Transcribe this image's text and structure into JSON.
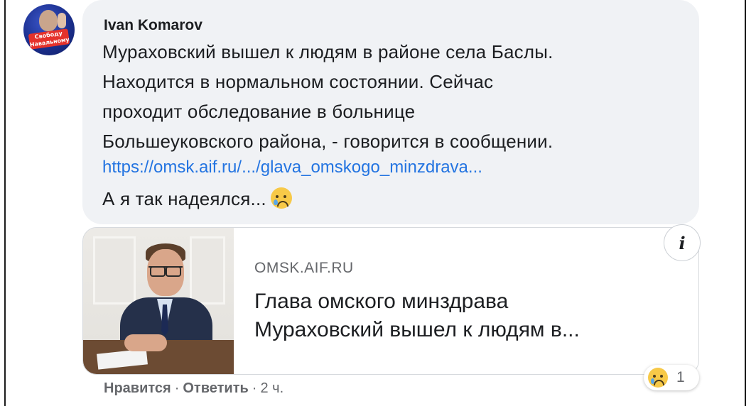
{
  "comment": {
    "author": "Ivan Komarov",
    "lines": [
      "Мураховский вышел к людям в районе села Баслы.",
      "Находится в нормальном состоянии. Сейчас",
      "проходит обследование в больнице",
      "Большеуковского района, - говорится в сообщении."
    ],
    "link": "https://omsk.aif.ru/.../glava_omskogo_minzdrava...",
    "last_line": "А я так надеялся...",
    "inline_emoji": "crying-face-icon"
  },
  "avatar": {
    "badge_text": "Свободу Навальному"
  },
  "link_card": {
    "source": "OMSK.AIF.RU",
    "title_lines": [
      "Глава омского минздрава",
      "Мураховский вышел к людям в..."
    ],
    "info_glyph": "i"
  },
  "reaction": {
    "icon": "crying-face-icon",
    "count": "1"
  },
  "actions": {
    "like": "Нравится",
    "reply": "Ответить",
    "time": "2 ч.",
    "separator": "·"
  },
  "colors": {
    "bubble_bg": "#f0f2f5",
    "link": "#2374e1",
    "secondary_text": "#65676b",
    "primary_text": "#1c1e21"
  }
}
